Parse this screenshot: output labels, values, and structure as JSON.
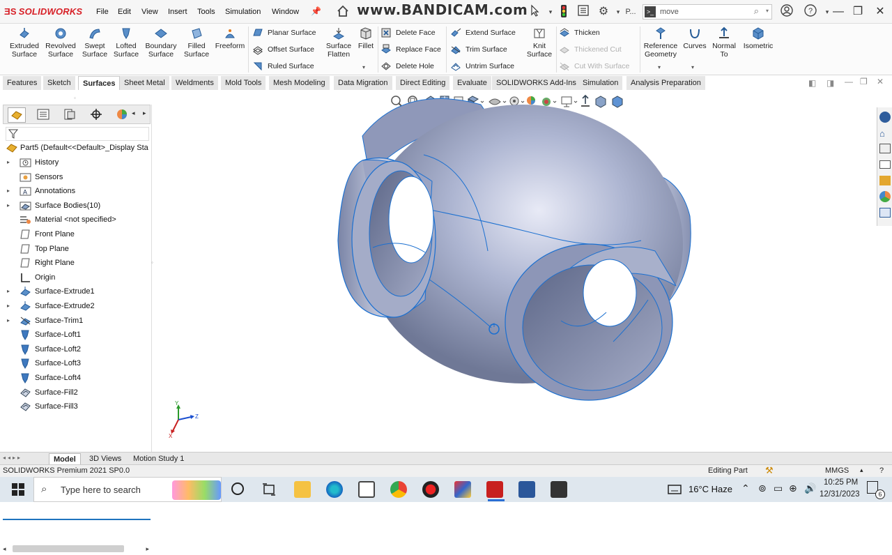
{
  "app": {
    "brand": "SOLIDWORKS",
    "version_label": "SOLIDWORKS Premium 2021 SP0.0"
  },
  "menu": [
    "File",
    "Edit",
    "View",
    "Insert",
    "Tools",
    "Simulation",
    "Window"
  ],
  "watermark": "www.BANDICAM.com",
  "titlebar": {
    "file_short": "P...",
    "search_value": "move"
  },
  "ribbon": {
    "big_left": [
      {
        "label": "Extruded\nSurface"
      },
      {
        "label": "Revolved\nSurface"
      },
      {
        "label": "Swept\nSurface"
      },
      {
        "label": "Lofted\nSurface"
      },
      {
        "label": "Boundary\nSurface"
      },
      {
        "label": "Filled\nSurface"
      },
      {
        "label": "Freeform"
      }
    ],
    "col1": [
      "Planar Surface",
      "Offset Surface",
      "Ruled Surface"
    ],
    "mid_big": [
      {
        "label": "Surface\nFlatten"
      },
      {
        "label": "Fillet"
      }
    ],
    "col2": [
      "Delete Face",
      "Replace Face",
      "Delete Hole"
    ],
    "col3": [
      "Extend Surface",
      "Trim Surface",
      "Untrim Surface"
    ],
    "knit": "Knit\nSurface",
    "col4": [
      {
        "label": "Thicken",
        "enabled": true
      },
      {
        "label": "Thickened Cut",
        "enabled": false
      },
      {
        "label": "Cut With Surface",
        "enabled": false
      }
    ],
    "right_big": [
      {
        "label": "Reference\nGeometry"
      },
      {
        "label": "Curves"
      },
      {
        "label": "Normal\nTo"
      },
      {
        "label": "Isometric"
      }
    ]
  },
  "tabs": [
    "Features",
    "Sketch",
    "Surfaces",
    "Sheet Metal",
    "Weldments",
    "Mold Tools",
    "Mesh Modeling",
    "Data Migration",
    "Direct Editing",
    "Evaluate",
    "SOLIDWORKS Add-Ins",
    "Simulation",
    "Analysis Preparation"
  ],
  "active_tab": "Surfaces",
  "tree": {
    "root": "Part5  (Default<<Default>_Display Sta",
    "items": [
      {
        "label": "History",
        "expandable": true,
        "icon": "history-folder-icon"
      },
      {
        "label": "Sensors",
        "expandable": false,
        "icon": "sensor-icon"
      },
      {
        "label": "Annotations",
        "expandable": true,
        "icon": "annotations-icon"
      },
      {
        "label": "Surface Bodies(10)",
        "expandable": true,
        "icon": "surface-bodies-icon"
      },
      {
        "label": "Material <not specified>",
        "expandable": false,
        "icon": "material-icon"
      },
      {
        "label": "Front Plane",
        "expandable": false,
        "icon": "plane-icon"
      },
      {
        "label": "Top Plane",
        "expandable": false,
        "icon": "plane-icon"
      },
      {
        "label": "Right Plane",
        "expandable": false,
        "icon": "plane-icon"
      },
      {
        "label": "Origin",
        "expandable": false,
        "icon": "origin-icon"
      },
      {
        "label": "Surface-Extrude1",
        "expandable": true,
        "icon": "surface-extrude-icon"
      },
      {
        "label": "Surface-Extrude2",
        "expandable": true,
        "icon": "surface-extrude-icon"
      },
      {
        "label": "Surface-Trim1",
        "expandable": true,
        "icon": "surface-trim-icon"
      },
      {
        "label": "Surface-Loft1",
        "expandable": false,
        "icon": "surface-loft-icon"
      },
      {
        "label": "Surface-Loft2",
        "expandable": false,
        "icon": "surface-loft-icon"
      },
      {
        "label": "Surface-Loft3",
        "expandable": false,
        "icon": "surface-loft-icon"
      },
      {
        "label": "Surface-Loft4",
        "expandable": false,
        "icon": "surface-loft-icon"
      },
      {
        "label": "Surface-Fill2",
        "expandable": false,
        "icon": "surface-fill-icon"
      },
      {
        "label": "Surface-Fill3",
        "expandable": false,
        "icon": "surface-fill-icon"
      }
    ]
  },
  "triad": {
    "y": "Y",
    "x": "X",
    "z": "Z"
  },
  "bottom_tabs": [
    "Model",
    "3D Views",
    "Motion Study 1"
  ],
  "active_bottom_tab": "Model",
  "status": {
    "mode": "Editing Part",
    "units": "MMGS"
  },
  "taskbar": {
    "search_placeholder": "Type here to search",
    "weather": "16°C  Haze",
    "time": "10:25 PM",
    "date": "12/31/2023",
    "notifications": "6"
  },
  "colors": {
    "brand_red": "#d71f26",
    "part_blue": "#9aa6c6",
    "edge_blue": "#1a6fd0",
    "active_blue": "#1e73be"
  }
}
